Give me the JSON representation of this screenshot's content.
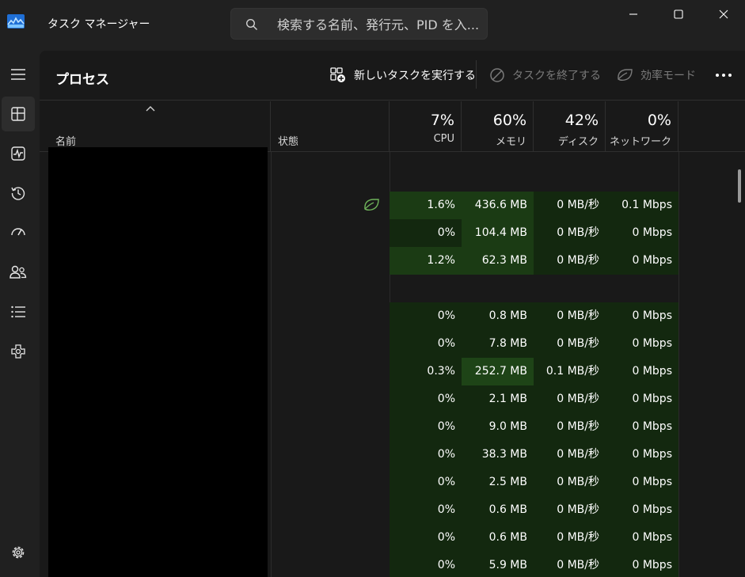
{
  "window": {
    "title": "タスク マネージャー",
    "search_placeholder": "検索する名前、発行元、PID を入..."
  },
  "nav": [
    {
      "name": "hamburger-menu-icon"
    },
    {
      "name": "processes-icon",
      "active": true
    },
    {
      "name": "performance-icon"
    },
    {
      "name": "app-history-icon"
    },
    {
      "name": "startup-apps-icon"
    },
    {
      "name": "users-icon"
    },
    {
      "name": "details-icon"
    },
    {
      "name": "services-icon"
    },
    {
      "name": "settings-icon"
    }
  ],
  "toolbar": {
    "page_title": "プロセス",
    "new_task": "新しいタスクを実行する",
    "end_task": "タスクを終了する",
    "efficiency_mode": "効率モード"
  },
  "columns": {
    "name": "名前",
    "status": "状態",
    "cpu": {
      "percent": "7%",
      "label": "CPU"
    },
    "memory": {
      "percent": "60%",
      "label": "メモリ"
    },
    "disk": {
      "percent": "42%",
      "label": "ディスク"
    },
    "network": {
      "percent": "0%",
      "label": "ネットワーク"
    }
  },
  "colors": {
    "heat_low": "#13280f",
    "heat_mid": "#1b3b14",
    "heat_high": "#1e4417",
    "accent": "#6fb35a"
  },
  "rows": [
    {
      "blank": true
    },
    {
      "eco": true,
      "cpu": "1.6%",
      "mem": "436.6 MB",
      "disk": "0 MB/秒",
      "net": "0.1 Mbps",
      "h": [
        2,
        2,
        1,
        1
      ]
    },
    {
      "cpu": "0%",
      "mem": "104.4 MB",
      "disk": "0 MB/秒",
      "net": "0 Mbps",
      "h": [
        1,
        2,
        1,
        1
      ]
    },
    {
      "cpu": "1.2%",
      "mem": "62.3 MB",
      "disk": "0 MB/秒",
      "net": "0 Mbps",
      "h": [
        2,
        2,
        1,
        1
      ]
    },
    {
      "blank": true
    },
    {
      "cpu": "0%",
      "mem": "0.8 MB",
      "disk": "0 MB/秒",
      "net": "0 Mbps",
      "h": [
        1,
        1,
        1,
        1
      ]
    },
    {
      "cpu": "0%",
      "mem": "7.8 MB",
      "disk": "0 MB/秒",
      "net": "0 Mbps",
      "h": [
        1,
        1,
        1,
        1
      ]
    },
    {
      "cpu": "0.3%",
      "mem": "252.7 MB",
      "disk": "0.1 MB/秒",
      "net": "0 Mbps",
      "h": [
        1,
        3,
        1,
        1
      ]
    },
    {
      "cpu": "0%",
      "mem": "2.1 MB",
      "disk": "0 MB/秒",
      "net": "0 Mbps",
      "h": [
        1,
        1,
        1,
        1
      ]
    },
    {
      "cpu": "0%",
      "mem": "9.0 MB",
      "disk": "0 MB/秒",
      "net": "0 Mbps",
      "h": [
        1,
        1,
        1,
        1
      ]
    },
    {
      "cpu": "0%",
      "mem": "38.3 MB",
      "disk": "0 MB/秒",
      "net": "0 Mbps",
      "h": [
        1,
        1,
        1,
        1
      ]
    },
    {
      "cpu": "0%",
      "mem": "2.5 MB",
      "disk": "0 MB/秒",
      "net": "0 Mbps",
      "h": [
        1,
        1,
        1,
        1
      ]
    },
    {
      "cpu": "0%",
      "mem": "0.6 MB",
      "disk": "0 MB/秒",
      "net": "0 Mbps",
      "h": [
        1,
        1,
        1,
        1
      ]
    },
    {
      "cpu": "0%",
      "mem": "0.6 MB",
      "disk": "0 MB/秒",
      "net": "0 Mbps",
      "h": [
        1,
        1,
        1,
        1
      ]
    },
    {
      "cpu": "0%",
      "mem": "5.9 MB",
      "disk": "0 MB/秒",
      "net": "0 Mbps",
      "h": [
        1,
        1,
        1,
        1
      ]
    }
  ]
}
